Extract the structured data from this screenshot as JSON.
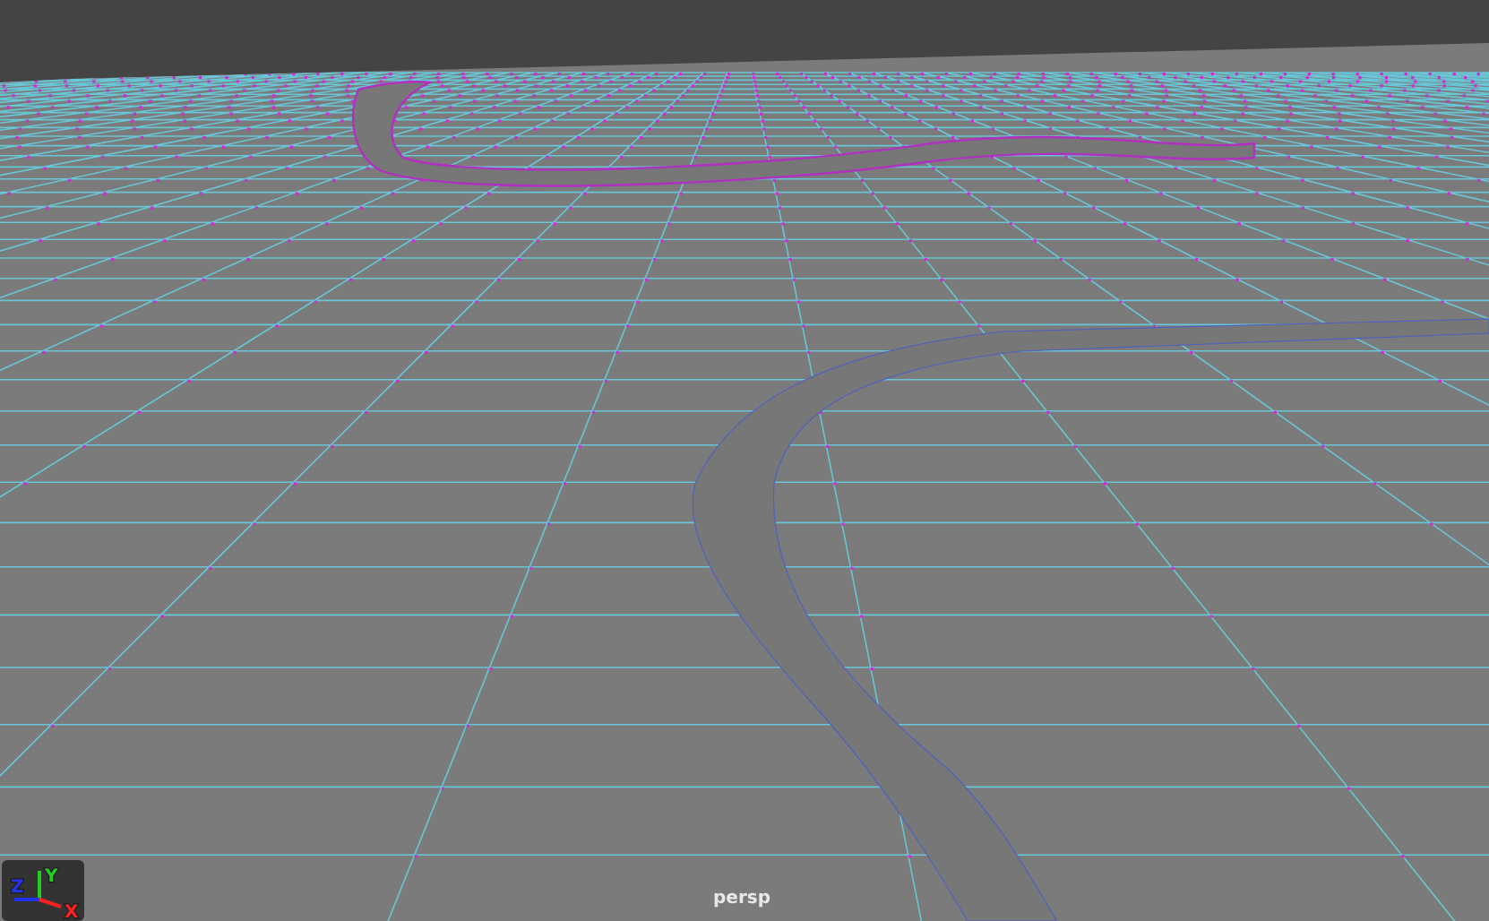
{
  "viewport": {
    "camera_label": "persp",
    "axes": [
      {
        "kind": "y",
        "label": "Y",
        "color": "#22cc22"
      },
      {
        "kind": "z",
        "label": "Z",
        "color": "#2233ee"
      },
      {
        "kind": "x",
        "label": "X",
        "color": "#ff2020"
      }
    ]
  }
}
